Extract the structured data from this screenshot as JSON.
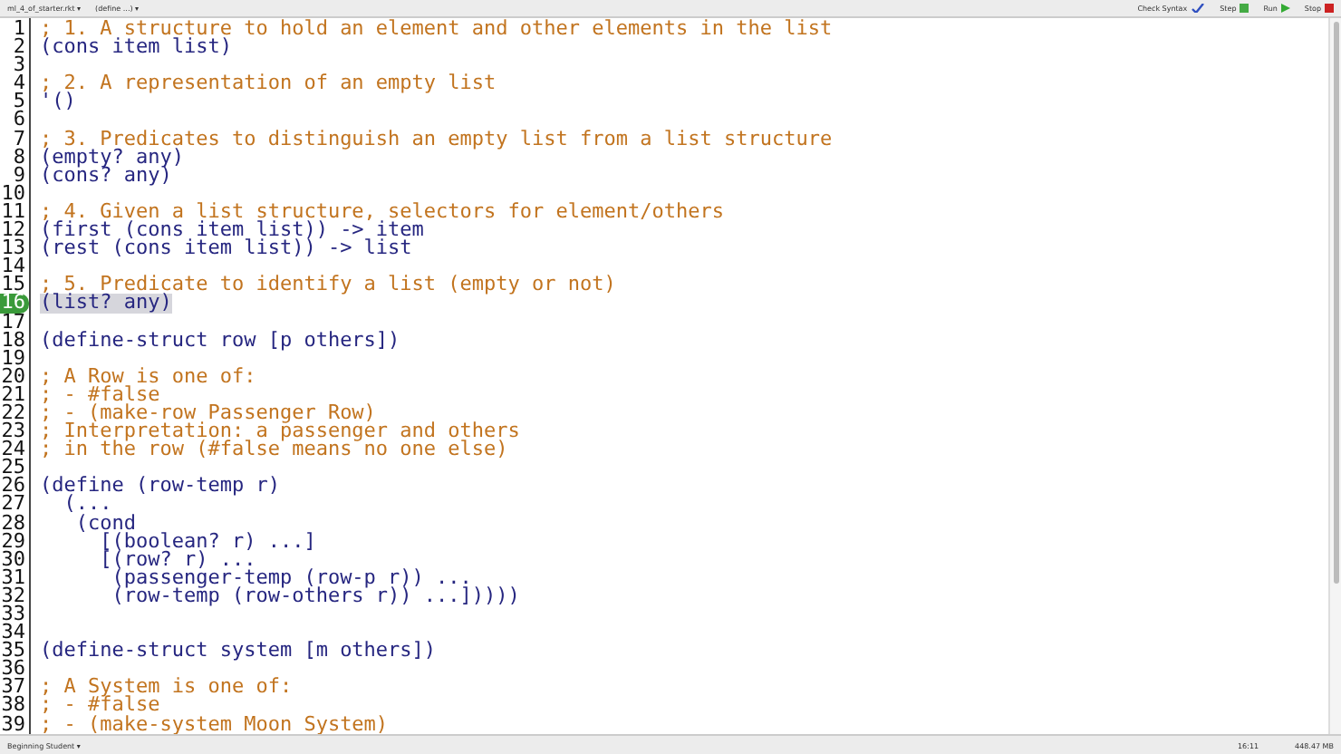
{
  "toolbar": {
    "file_menu": "ml_4_of_starter.rkt ▾",
    "define_menu": "(define ...) ▾",
    "buttons": [
      {
        "label": "Check Syntax",
        "kind": "check"
      },
      {
        "label": "Step",
        "kind": "step"
      },
      {
        "label": "Run",
        "kind": "run"
      },
      {
        "label": "Stop",
        "kind": "stop"
      }
    ]
  },
  "editor": {
    "lines": [
      {
        "number": "1",
        "kind": "comment",
        "text": "; 1. A structure to hold an element and other elements in the list",
        "selected": false
      },
      {
        "number": "2",
        "kind": "code",
        "text": "(cons item list)",
        "selected": false
      },
      {
        "number": "3",
        "kind": "blank",
        "selected": false
      },
      {
        "number": "4",
        "kind": "comment",
        "text": "; 2. A representation of an empty list",
        "selected": false
      },
      {
        "number": "5",
        "kind": "code",
        "text": "'()",
        "selected": false
      },
      {
        "number": "6",
        "kind": "blank",
        "selected": false
      },
      {
        "number": "7",
        "kind": "comment",
        "text": "; 3. Predicates to distinguish an empty list from a list structure",
        "selected": false
      },
      {
        "number": "8",
        "kind": "code",
        "text": "(empty? any)",
        "selected": false
      },
      {
        "number": "9",
        "kind": "code",
        "text": "(cons? any)",
        "selected": false
      },
      {
        "number": "10",
        "kind": "blank",
        "selected": false
      },
      {
        "number": "11",
        "kind": "comment",
        "text": "; 4. Given a list structure, selectors for element/others",
        "selected": false
      },
      {
        "number": "12",
        "kind": "code",
        "text": "(first (cons item list)) -> item",
        "selected": false
      },
      {
        "number": "13",
        "kind": "code",
        "text": "(rest (cons item list)) -> list",
        "selected": false
      },
      {
        "number": "14",
        "kind": "blank",
        "selected": false
      },
      {
        "number": "15",
        "kind": "comment",
        "text": "; 5. Predicate to identify a list (empty or not)",
        "selected": false
      },
      {
        "number": "16",
        "kind": "code",
        "text": "(list? any)",
        "selected": true
      },
      {
        "number": "17",
        "kind": "blank",
        "selected": false
      },
      {
        "number": "18",
        "kind": "code",
        "text": "(define-struct row [p others])",
        "selected": false
      },
      {
        "number": "19",
        "kind": "blank",
        "selected": false
      },
      {
        "number": "20",
        "kind": "comment",
        "text": "; A Row is one of:",
        "selected": false
      },
      {
        "number": "21",
        "kind": "comment",
        "text": "; - #false",
        "selected": false
      },
      {
        "number": "22",
        "kind": "comment",
        "text": "; - (make-row Passenger Row)",
        "selected": false
      },
      {
        "number": "23",
        "kind": "comment",
        "text": "; Interpretation: a passenger and others",
        "selected": false
      },
      {
        "number": "24",
        "kind": "comment",
        "text": "; in the row (#false means no one else)",
        "selected": false
      },
      {
        "number": "25",
        "kind": "blank",
        "selected": false
      },
      {
        "number": "26",
        "kind": "code",
        "text": "(define (row-temp r)",
        "selected": false
      },
      {
        "number": "27",
        "kind": "code",
        "text": "  (...",
        "selected": false
      },
      {
        "number": "28",
        "kind": "code",
        "text": "   (cond",
        "selected": false
      },
      {
        "number": "29",
        "kind": "code",
        "text": "     [(boolean? r) ...]",
        "selected": false
      },
      {
        "number": "30",
        "kind": "code",
        "text": "     [(row? r) ...",
        "selected": false
      },
      {
        "number": "31",
        "kind": "code",
        "text": "      (passenger-temp (row-p r)) ...",
        "selected": false
      },
      {
        "number": "32",
        "kind": "code",
        "text": "      (row-temp (row-others r)) ...]))))",
        "selected": false
      },
      {
        "number": "33",
        "kind": "blank",
        "selected": false
      },
      {
        "number": "34",
        "kind": "blank",
        "selected": false
      },
      {
        "number": "35",
        "kind": "code",
        "text": "(define-struct system [m others])",
        "selected": false
      },
      {
        "number": "36",
        "kind": "blank",
        "selected": false
      },
      {
        "number": "37",
        "kind": "comment",
        "text": "; A System is one of:",
        "selected": false
      },
      {
        "number": "38",
        "kind": "comment",
        "text": "; - #false",
        "selected": false
      },
      {
        "number": "39",
        "kind": "comment",
        "text": "; - (make-system Moon System)",
        "selected": false
      }
    ]
  },
  "status_bar": {
    "language": "Beginning Student ▾",
    "position": "16:11",
    "memory": "448.47 MB"
  }
}
